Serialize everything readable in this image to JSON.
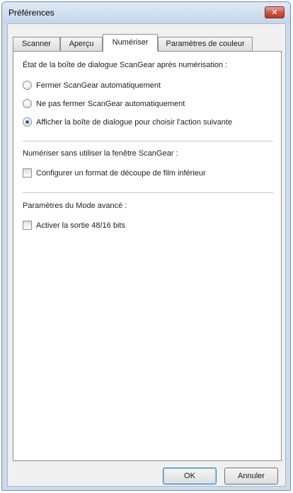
{
  "window": {
    "title": "Préférences"
  },
  "tabs": [
    {
      "label": "Scanner"
    },
    {
      "label": "Aperçu"
    },
    {
      "label": "Numériser"
    },
    {
      "label": "Paramètres de couleur"
    }
  ],
  "active_tab": "Numériser",
  "sections": {
    "after_scan": {
      "heading": "État de la boîte de dialogue ScanGear après numérisation :",
      "options": [
        {
          "label": "Fermer ScanGear automatiquement",
          "selected": false
        },
        {
          "label": "Ne pas fermer ScanGear automatiquement",
          "selected": false
        },
        {
          "label": "Afficher la boîte de dialogue pour choisir l'action suivante",
          "selected": true
        }
      ]
    },
    "without_window": {
      "heading": "Numériser sans utiliser la fenêtre ScanGear :",
      "checkbox_label": "Configurer un format de découpe de film inférieur",
      "checked": false
    },
    "advanced": {
      "heading": "Paramètres du Mode avancé :",
      "checkbox_label": "Activer la sortie 48/16 bits",
      "checked": false
    }
  },
  "buttons": {
    "ok": "OK",
    "cancel": "Annuler"
  },
  "icons": {
    "close": "close-icon"
  }
}
